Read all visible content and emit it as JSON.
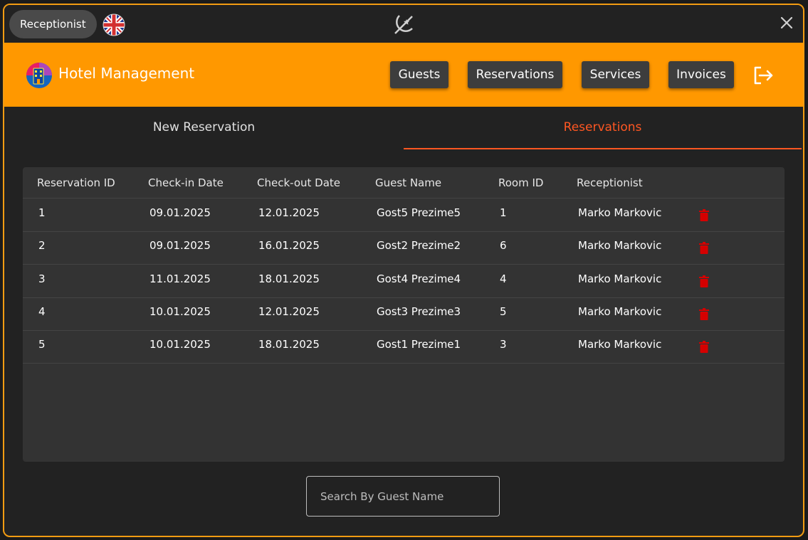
{
  "titlebar": {
    "role_label": "Receptionist"
  },
  "header": {
    "app_title": "Hotel Management",
    "nav": [
      {
        "label": "Guests"
      },
      {
        "label": "Reservations"
      },
      {
        "label": "Services"
      },
      {
        "label": "Invoices"
      }
    ]
  },
  "tabs": [
    {
      "label": "New Reservation",
      "active": false
    },
    {
      "label": "Reservations",
      "active": true
    }
  ],
  "table": {
    "columns": [
      "Reservation ID",
      "Check-in Date",
      "Check-out Date",
      "Guest Name",
      "Room ID",
      "Receptionist"
    ],
    "rows": [
      [
        "1",
        "09.01.2025",
        "12.01.2025",
        "Gost5 Prezime5",
        "1",
        "Marko Markovic"
      ],
      [
        "2",
        "09.01.2025",
        "16.01.2025",
        "Gost2 Prezime2",
        "6",
        "Marko Markovic"
      ],
      [
        "3",
        "11.01.2025",
        "18.01.2025",
        "Gost4 Prezime4",
        "4",
        "Marko Markovic"
      ],
      [
        "4",
        "10.01.2025",
        "12.01.2025",
        "Gost3 Prezime3",
        "5",
        "Marko Markovic"
      ],
      [
        "5",
        "10.01.2025",
        "18.01.2025",
        "Gost1 Prezime1",
        "3",
        "Marko Markovic"
      ]
    ]
  },
  "search": {
    "placeholder": "Search By Guest Name",
    "value": ""
  },
  "icons": {
    "flag": "uk-flag-icon",
    "theme": "theme-toggle-icon",
    "close": "close-icon",
    "logo": "hotel-logo-icon",
    "logout": "logout-icon",
    "delete": "trash-icon"
  },
  "colors": {
    "accent": "#ff9800",
    "active_tab": "#ff5722",
    "delete": "#d50000",
    "border": "#f39c12"
  }
}
